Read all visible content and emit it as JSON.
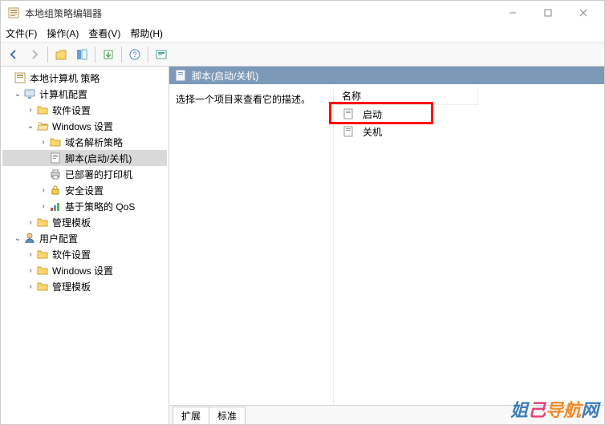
{
  "window": {
    "title": "本地组策略编辑器"
  },
  "menu": {
    "file": "文件(F)",
    "action": "操作(A)",
    "view": "查看(V)",
    "help": "帮助(H)"
  },
  "tree": {
    "root": "本地计算机 策略",
    "computer_config": "计算机配置",
    "cc_children": {
      "software_settings": "软件设置",
      "windows_settings": "Windows 设置",
      "ws_children": {
        "name_resolution": "域名解析策略",
        "scripts": "脚本(启动/关机)",
        "deployed_printers": "已部署的打印机",
        "security_settings": "安全设置",
        "policy_qos": "基于策略的 QoS"
      },
      "admin_templates": "管理模板"
    },
    "user_config": "用户配置",
    "uc_children": {
      "software_settings": "软件设置",
      "windows_settings": "Windows 设置",
      "admin_templates": "管理模板"
    }
  },
  "right": {
    "header": "脚本(启动/关机)",
    "desc": "选择一个项目来查看它的描述。",
    "list_header": "名称",
    "item_startup": "启动",
    "item_shutdown": "关机"
  },
  "tabs": {
    "extended": "扩展",
    "standard": "标准"
  },
  "watermark": {
    "t1": "姐",
    "t2": "己",
    "t3": "导航",
    "t4": "网"
  }
}
